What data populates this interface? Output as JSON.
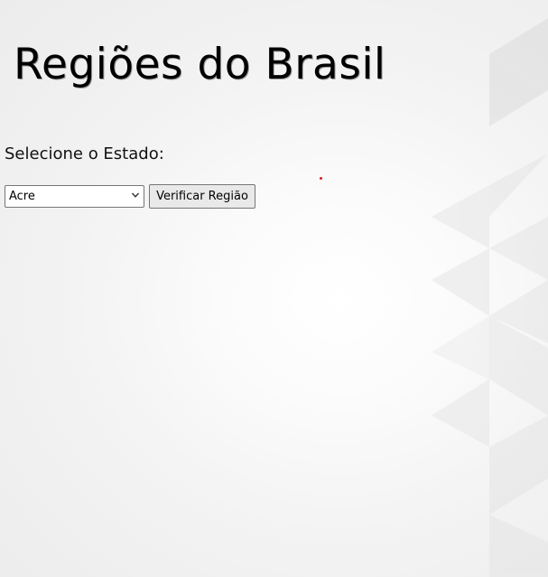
{
  "page": {
    "title": "Regiões do Brasil",
    "select_label": "Selecione o Estado:",
    "selected_state": "Acre",
    "verify_button": "Verificar Região"
  },
  "icons": {
    "select_arrow": "chevron-down-icon"
  },
  "colors": {
    "background": "#f3f3f3",
    "triangle_shade": "#e4e4e4",
    "dot": "#d42020"
  }
}
